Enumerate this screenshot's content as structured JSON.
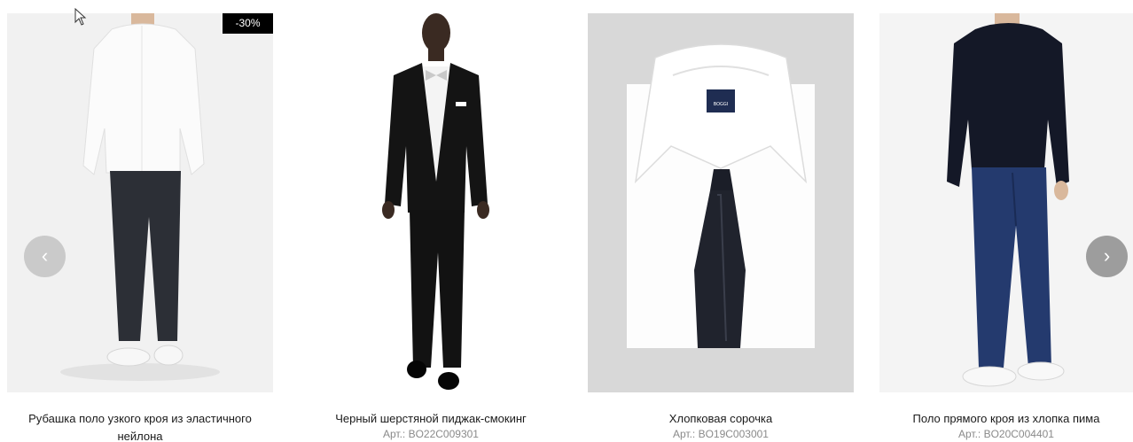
{
  "products": [
    {
      "title": "Рубашка поло узкого кроя из эластичного нейлона",
      "sku": "",
      "badge": "-30%",
      "image": "man-white-shirt-dark-trousers"
    },
    {
      "title": "Черный шерстяной пиджак-смокинг",
      "sku": "Арт.: BO22C009301",
      "image": "man-black-tuxedo"
    },
    {
      "title": "Хлопковая сорочка",
      "sku": "Арт.: BO19C003001",
      "image": "folded-white-shirt-black-tie",
      "label_text": "BOGGI"
    },
    {
      "title": "Поло прямого кроя из хлопка пима",
      "sku": "Арт.: BO20C004401",
      "image": "man-navy-polo-jeans"
    }
  ],
  "nav": {
    "prev_icon": "chevron-left-icon",
    "next_icon": "chevron-right-icon",
    "prev_glyph": "‹",
    "next_glyph": "›"
  },
  "colors": {
    "badge_bg": "#000000",
    "photo_bg": "#efefef",
    "sku_text": "#8a8a8a"
  }
}
